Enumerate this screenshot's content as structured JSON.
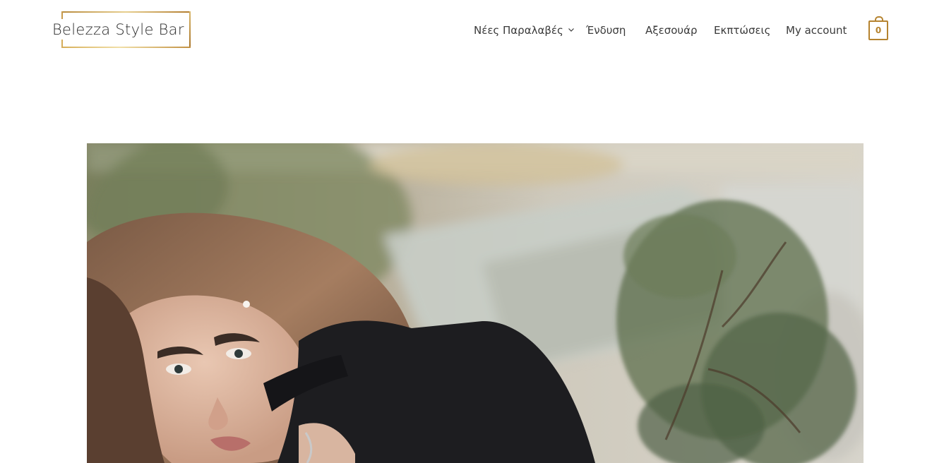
{
  "header": {
    "logo": {
      "text": "Belezza Style Bar"
    },
    "nav": [
      {
        "label": "Νέες Παραλαβές",
        "has_dropdown": true,
        "icon": "chevron-down-icon"
      },
      {
        "label": "Ένδυση"
      },
      {
        "label": "Αξεσουάρ"
      },
      {
        "label": "Εκπτώσεις"
      },
      {
        "label": "My account"
      }
    ],
    "cart": {
      "count": "0",
      "icon": "shopping-bag-icon"
    }
  },
  "colors": {
    "accent_gold": "#b5832f",
    "nav_text": "#3a3a3a",
    "logo_text": "#2c2c2c",
    "background": "#ffffff"
  },
  "hero": {
    "image": "model-photo"
  }
}
